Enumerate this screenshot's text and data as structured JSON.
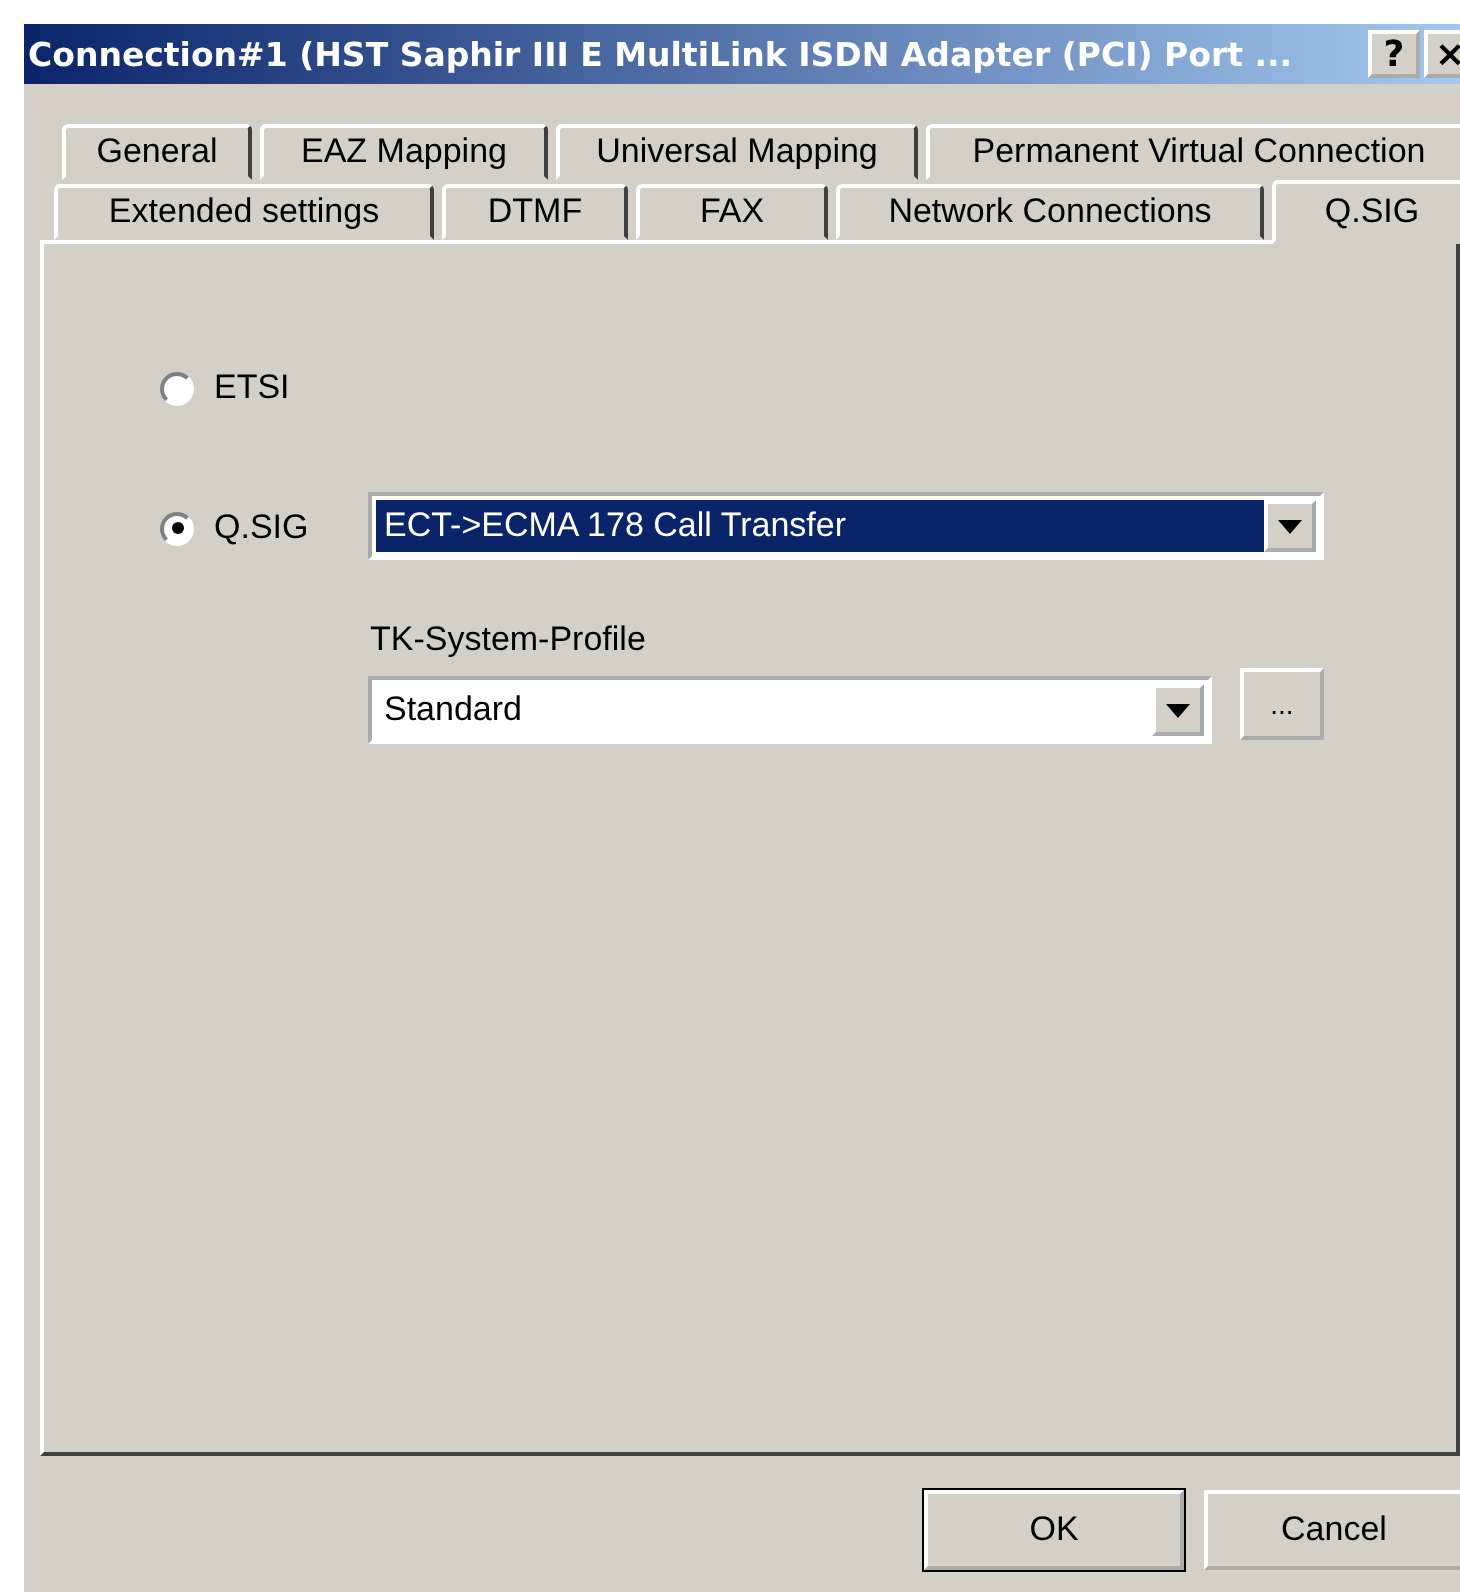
{
  "window": {
    "title": "Connection#1 (HST Saphir III E MultiLink ISDN Adapter (PCI) Port ...",
    "help_button": "?",
    "close_button": "×"
  },
  "tab_rows": [
    [
      {
        "label": "General",
        "selected": false
      },
      {
        "label": "EAZ Mapping",
        "selected": false
      },
      {
        "label": "Universal Mapping",
        "selected": false
      },
      {
        "label": "Permanent Virtual Connection",
        "selected": false
      }
    ],
    [
      {
        "label": "Extended settings",
        "selected": false
      },
      {
        "label": "DTMF",
        "selected": false
      },
      {
        "label": "FAX",
        "selected": false
      },
      {
        "label": "Network Connections",
        "selected": false
      },
      {
        "label": "Q.SIG",
        "selected": true
      }
    ]
  ],
  "options": [
    {
      "label": "ETSI",
      "selected": false
    },
    {
      "label": "Q.SIG",
      "selected": true
    }
  ],
  "qsig_dropdown": {
    "value": "ECT->ECMA 178 Call Transfer",
    "focused": true
  },
  "profile": {
    "label": "TK-System-Profile",
    "value": "Standard",
    "browse_button": "..."
  },
  "buttons": [
    {
      "label": "OK",
      "default": true
    },
    {
      "label": "Cancel",
      "default": false
    }
  ]
}
